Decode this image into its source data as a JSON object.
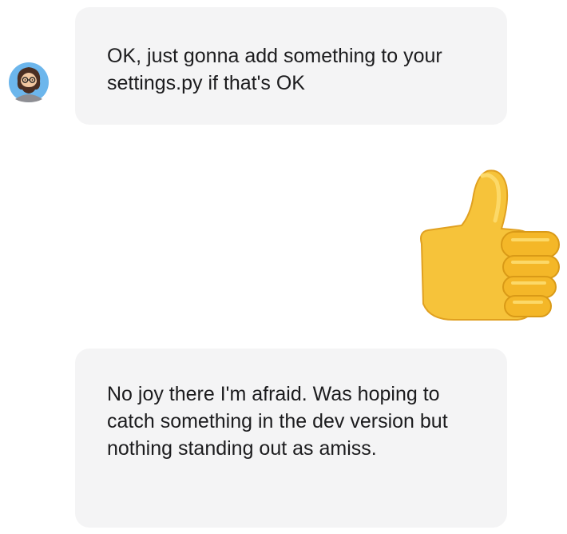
{
  "messages": [
    {
      "sender": "other",
      "text": "OK, just gonna add something to your settings.py if that's OK"
    },
    {
      "sender": "me",
      "type": "emoji",
      "emoji": "thumbs-up"
    },
    {
      "sender": "other",
      "text": "No joy there I'm afraid. Was hoping to catch something in the dev version but nothing standing out as amiss."
    }
  ]
}
